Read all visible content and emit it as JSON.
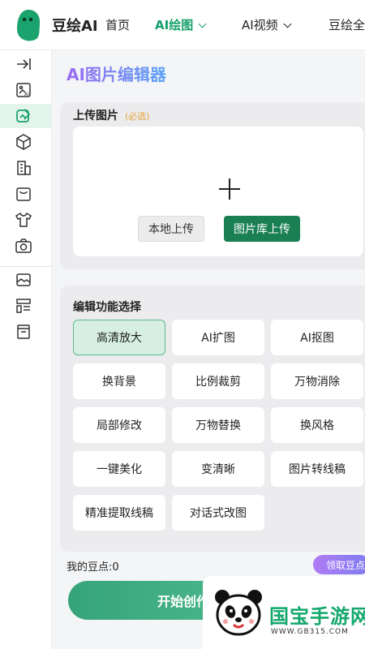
{
  "header": {
    "brand": "豆绘AI",
    "nav": [
      {
        "label": "首页"
      },
      {
        "label": "AI绘图"
      },
      {
        "label": "AI视频"
      },
      {
        "label": "豆绘全"
      }
    ]
  },
  "page": {
    "title": "AI图片编辑器"
  },
  "upload": {
    "label": "上传图片",
    "required": "(必选)",
    "local_button": "本地上传",
    "library_button": "图片库上传"
  },
  "functions": {
    "label": "编辑功能选择",
    "items": [
      {
        "label": "高清放大"
      },
      {
        "label": "AI扩图"
      },
      {
        "label": "AI抠图"
      },
      {
        "label": "换背景"
      },
      {
        "label": "比例裁剪"
      },
      {
        "label": "万物消除"
      },
      {
        "label": "局部修改"
      },
      {
        "label": "万物替换"
      },
      {
        "label": "换风格"
      },
      {
        "label": "一键美化"
      },
      {
        "label": "变清晰"
      },
      {
        "label": "图片转线稿"
      },
      {
        "label": "精准提取线稿"
      },
      {
        "label": "对话式改图"
      }
    ]
  },
  "footer": {
    "points": "我的豆点:0",
    "get_points": "领取豆点",
    "start": "开始创作"
  },
  "watermark": {
    "text": "国宝手游网",
    "url": "WWW.GB315.COM"
  },
  "colors": {
    "accent": "#15a06b",
    "primary_button": "#1a7f52",
    "title_gradient_start": "#9b6cf2",
    "title_gradient_end": "#5aa2f5"
  }
}
